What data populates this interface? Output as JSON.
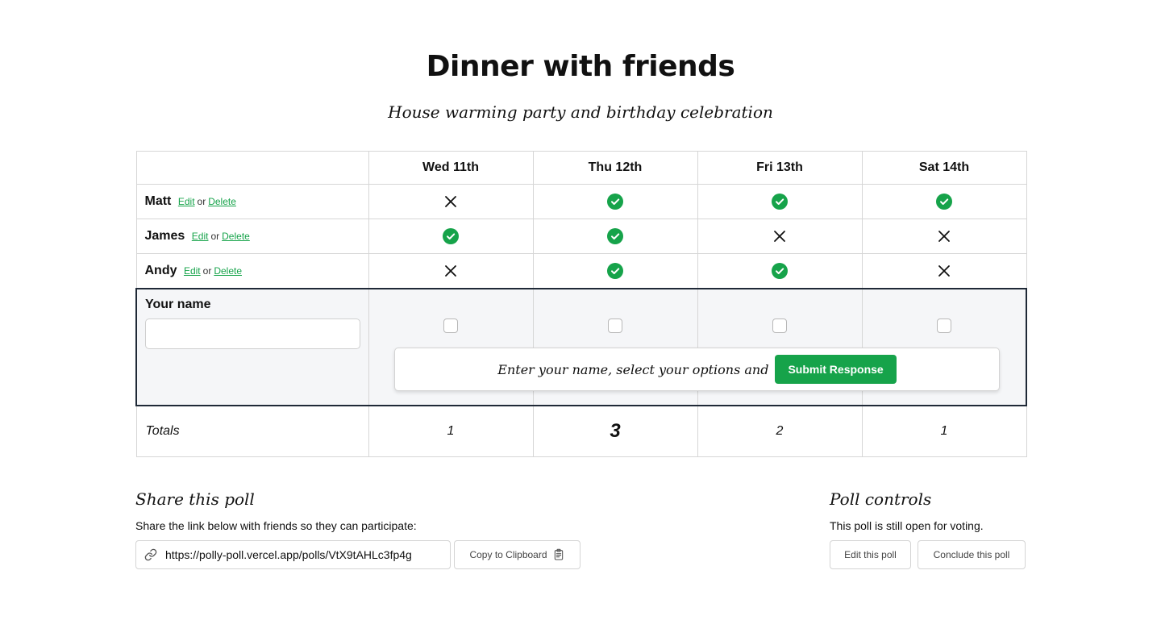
{
  "poll": {
    "title": "Dinner with friends",
    "subtitle": "House warming party and birthday celebration"
  },
  "dates": [
    "Wed 11th",
    "Thu 12th",
    "Fri 13th",
    "Sat 14th"
  ],
  "participants": [
    {
      "name": "Matt",
      "edit": "Edit",
      "or": "or",
      "delete": "Delete",
      "votes": [
        "no",
        "yes",
        "yes",
        "yes"
      ]
    },
    {
      "name": "James",
      "edit": "Edit",
      "or": "or",
      "delete": "Delete",
      "votes": [
        "yes",
        "yes",
        "no",
        "no"
      ]
    },
    {
      "name": "Andy",
      "edit": "Edit",
      "or": "or",
      "delete": "Delete",
      "votes": [
        "no",
        "yes",
        "yes",
        "no"
      ]
    }
  ],
  "entry": {
    "label": "Your name",
    "name_value": "",
    "checkboxes": [
      false,
      false,
      false,
      false
    ],
    "prompt": "Enter your name, select your options and",
    "submit_label": "Submit Response"
  },
  "totals": {
    "label": "Totals",
    "values": [
      "1",
      "3",
      "2",
      "1"
    ]
  },
  "share": {
    "heading": "Share this poll",
    "description": "Share the link below with friends so they can participate:",
    "url": "https://polly-poll.vercel.app/polls/VtX9tAHLc3fp4g",
    "copy_label": "Copy to Clipboard",
    "link_icon": "link-icon",
    "copy_icon": "clipboard-icon"
  },
  "controls": {
    "heading": "Poll controls",
    "status": "This poll is still open for voting.",
    "edit_label": "Edit this poll",
    "conclude_label": "Conclude this poll"
  },
  "colors": {
    "accent": "#16a34a",
    "border_dark": "#1f2937",
    "entry_bg": "#f5f6f8"
  }
}
